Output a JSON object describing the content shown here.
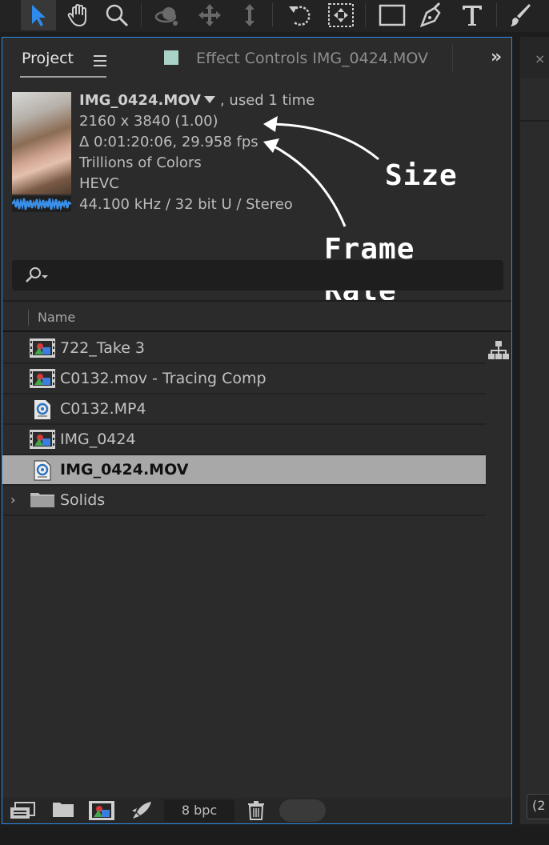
{
  "toolbar": {
    "tools": [
      "selection-tool",
      "hand-tool",
      "zoom-tool",
      "orbit-camera-tool",
      "pan-camera-tool",
      "dolly-camera-tool",
      "rotation-tool",
      "pan-behind-tool",
      "rectangle-tool",
      "pen-tool",
      "type-tool",
      "brush-tool"
    ]
  },
  "panel": {
    "tab_project": "Project",
    "tab_effect_controls": "Effect Controls IMG_0424.MOV",
    "effect_swatch_color": "#a9d3c8"
  },
  "footage_info": {
    "filename": "IMG_0424.MOV",
    "used": ", used 1 time",
    "size": "2160 x 3840 (1.00)",
    "duration_fps": "Δ 0:01:20:06, 29.958 fps",
    "color_depth": "Trillions of Colors",
    "codec": "HEVC",
    "audio": "44.100 kHz / 32 bit U / Stereo"
  },
  "annotations": {
    "size_label": "Size",
    "frame_label_1": "Frame",
    "frame_label_2": "Rate"
  },
  "search": {
    "placeholder": ""
  },
  "list": {
    "column_name": "Name",
    "items": [
      {
        "label": "722_Take 3",
        "icon": "composition-icon",
        "selected": false
      },
      {
        "label": "C0132.mov - Tracing Comp",
        "icon": "composition-icon",
        "selected": false
      },
      {
        "label": "C0132.MP4",
        "icon": "footage-file-icon",
        "selected": false
      },
      {
        "label": "IMG_0424",
        "icon": "composition-icon",
        "selected": false
      },
      {
        "label": "IMG_0424.MOV",
        "icon": "footage-file-icon",
        "selected": true
      },
      {
        "label": "Solids",
        "icon": "folder-icon",
        "selected": false
      }
    ]
  },
  "bottom_bar": {
    "bpc": "8 bpc"
  },
  "right_panel": {
    "bottom_text": "(2"
  },
  "colors": {
    "panel_border": "#2d8ceb",
    "selection": "#a8a8a8",
    "accent": "#2d8ceb"
  }
}
